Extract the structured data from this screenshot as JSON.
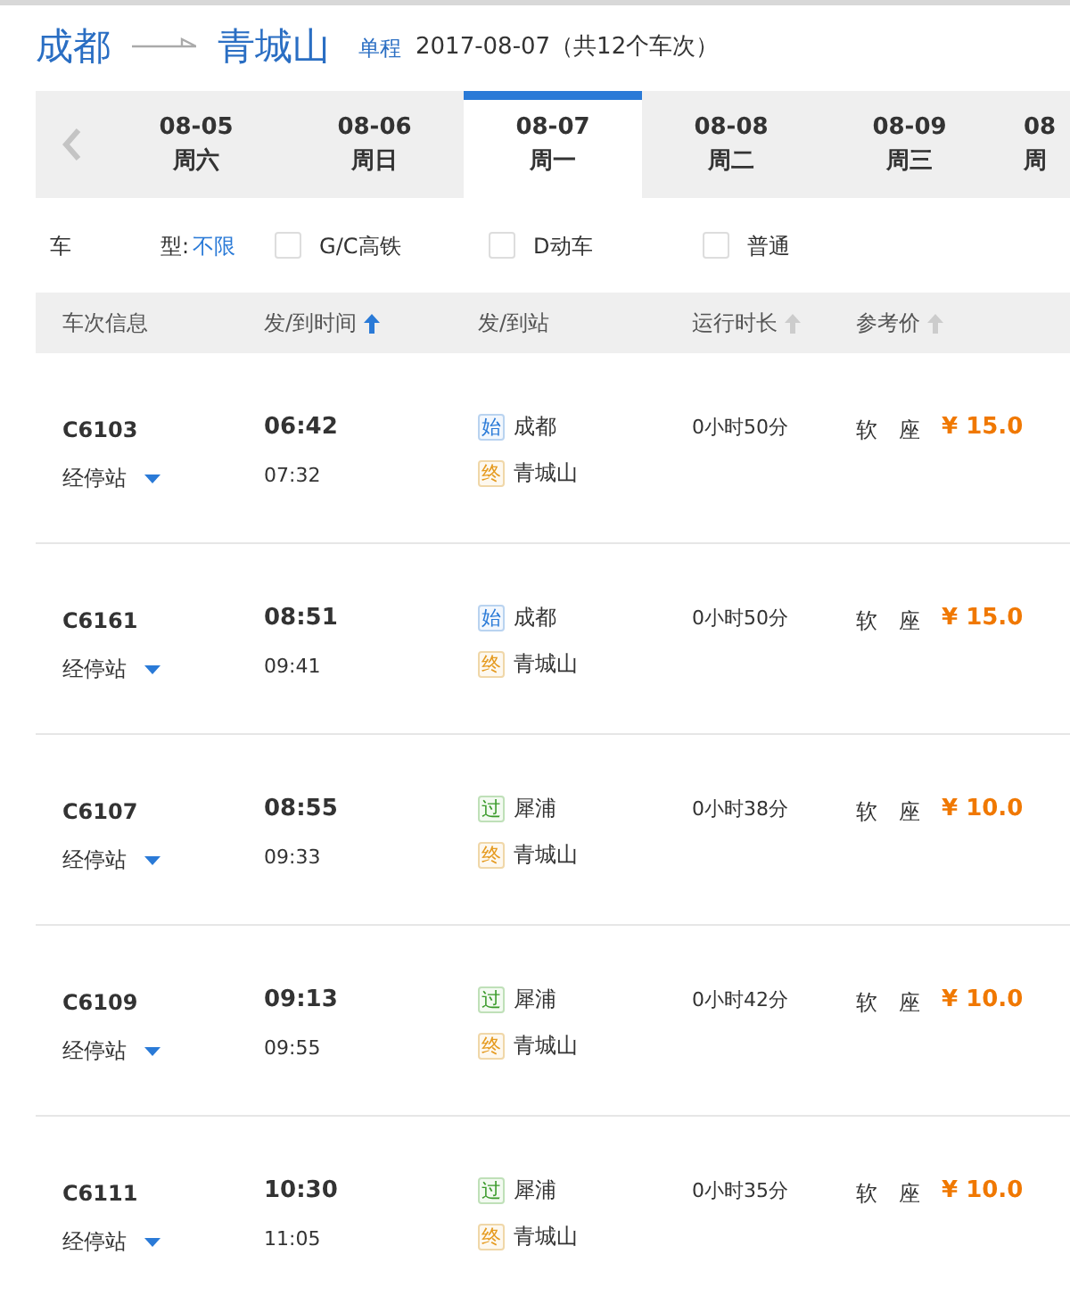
{
  "route": {
    "from": "成都",
    "to": "青城山",
    "trip_type": "单程",
    "summary": "2017-08-07（共12个车次）"
  },
  "date_tabs": [
    {
      "date": "08-05",
      "weekday": "周六",
      "selected": false
    },
    {
      "date": "08-06",
      "weekday": "周日",
      "selected": false
    },
    {
      "date": "08-07",
      "weekday": "周一",
      "selected": true
    },
    {
      "date": "08-08",
      "weekday": "周二",
      "selected": false
    },
    {
      "date": "08-09",
      "weekday": "周三",
      "selected": false
    },
    {
      "date": "08",
      "weekday": "周",
      "selected": false
    }
  ],
  "filter": {
    "label_1": "车",
    "label_2": "型:",
    "all_option": "不限",
    "options": [
      {
        "label": "G/C高铁",
        "checked": false
      },
      {
        "label": "D动车",
        "checked": false
      },
      {
        "label": "普通",
        "checked": false
      }
    ]
  },
  "columns": [
    {
      "label": "车次信息"
    },
    {
      "label": "发/到时间",
      "sort_active": true
    },
    {
      "label": "发/到站"
    },
    {
      "label": "运行时长",
      "sort_active": false
    },
    {
      "label": "参考价",
      "sort_active": false
    }
  ],
  "trains": [
    {
      "number": "C6103",
      "stops_link": "经停站",
      "depart": "06:42",
      "arrive": "07:32",
      "from_badge": {
        "kind": "start",
        "text": "始"
      },
      "from": "成都",
      "to_badge": {
        "kind": "end",
        "text": "终"
      },
      "to": "青城山",
      "duration": "0小时50分",
      "seat": "软　座",
      "price": "¥ 15.0"
    },
    {
      "number": "C6161",
      "stops_link": "经停站",
      "depart": "08:51",
      "arrive": "09:41",
      "from_badge": {
        "kind": "start",
        "text": "始"
      },
      "from": "成都",
      "to_badge": {
        "kind": "end",
        "text": "终"
      },
      "to": "青城山",
      "duration": "0小时50分",
      "seat": "软　座",
      "price": "¥ 15.0"
    },
    {
      "number": "C6107",
      "stops_link": "经停站",
      "depart": "08:55",
      "arrive": "09:33",
      "from_badge": {
        "kind": "pass",
        "text": "过"
      },
      "from": "犀浦",
      "to_badge": {
        "kind": "end",
        "text": "终"
      },
      "to": "青城山",
      "duration": "0小时38分",
      "seat": "软　座",
      "price": "¥ 10.0"
    },
    {
      "number": "C6109",
      "stops_link": "经停站",
      "depart": "09:13",
      "arrive": "09:55",
      "from_badge": {
        "kind": "pass",
        "text": "过"
      },
      "from": "犀浦",
      "to_badge": {
        "kind": "end",
        "text": "终"
      },
      "to": "青城山",
      "duration": "0小时42分",
      "seat": "软　座",
      "price": "¥ 10.0"
    },
    {
      "number": "C6111",
      "stops_link": "经停站",
      "depart": "10:30",
      "arrive": "11:05",
      "from_badge": {
        "kind": "pass",
        "text": "过"
      },
      "from": "犀浦",
      "to_badge": {
        "kind": "end",
        "text": "终"
      },
      "to": "青城山",
      "duration": "0小时35分",
      "seat": "软　座",
      "price": "¥ 10.0"
    }
  ]
}
